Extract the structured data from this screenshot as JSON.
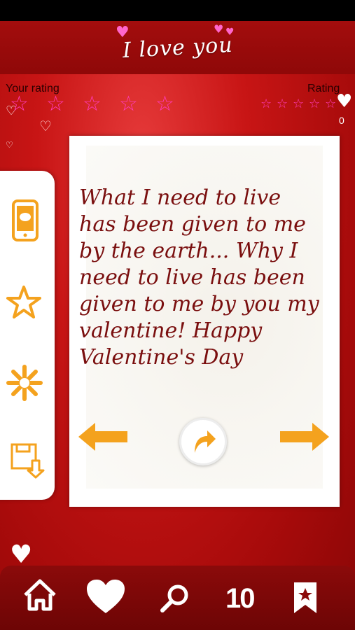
{
  "header": {
    "app_title": "I love you"
  },
  "rating": {
    "your_rating_label": "Your rating",
    "rating_label": "Rating",
    "user_stars": 5,
    "average_stars": 5,
    "rating_count": "0"
  },
  "quote": {
    "text": "What I need to live has been given to me by the earth... Why I need to live has been given to me by you my valentine! Happy Valentine's Day"
  },
  "side_menu": {
    "items": [
      {
        "icon": "sms-phone-icon"
      },
      {
        "icon": "star-icon"
      },
      {
        "icon": "snowflake-icon"
      },
      {
        "icon": "save-download-icon"
      }
    ]
  },
  "controls": {
    "previous_icon": "arrow-left-icon",
    "share_icon": "share-arrow-icon",
    "next_icon": "arrow-right-icon"
  },
  "bottom_nav": {
    "home_icon": "home-icon",
    "favorites_icon": "heart-icon",
    "search_icon": "search-icon",
    "top_label": "10",
    "bookmark_icon": "bookmark-icon"
  },
  "colors": {
    "background_red": "#c81515",
    "accent_orange": "#f4a21e",
    "star_pink": "#ff3bb8",
    "quote_text": "#7a0f0f"
  }
}
